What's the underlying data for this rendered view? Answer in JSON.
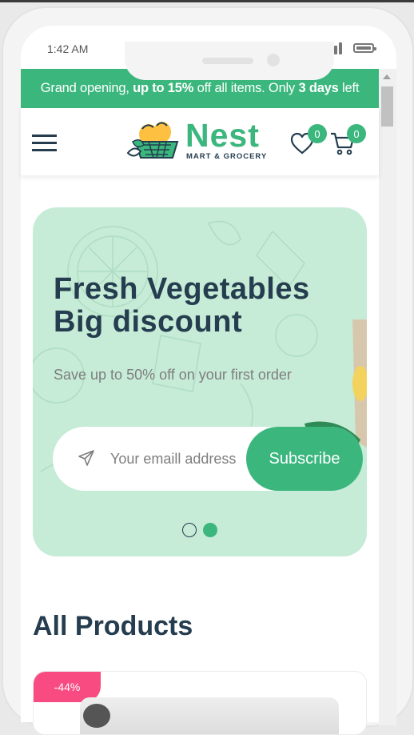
{
  "status": {
    "time": "1:42 AM",
    "signal_icon": "signal-bars-icon",
    "battery_icon": "battery-icon"
  },
  "announcement": {
    "prefix": "Grand opening, ",
    "highlight1": "up to 15%",
    "middle": " off all items. Only ",
    "highlight2": "3 days",
    "suffix": " left"
  },
  "header": {
    "menu_icon": "hamburger-menu-icon",
    "logo_name": "Nest",
    "logo_tagline": "MART & GROCERY",
    "wishlist_icon": "heart-icon",
    "wishlist_count": "0",
    "cart_icon": "shopping-cart-icon",
    "cart_count": "0"
  },
  "hero": {
    "title_line1": "Fresh Vegetables",
    "title_line2": "Big discount",
    "subtitle": "Save up to 50% off on your first order",
    "email_placeholder": "Your emaill address",
    "send_icon": "paper-plane-icon",
    "subscribe_label": "Subscribe",
    "slide_count": 2,
    "active_slide": 2
  },
  "products": {
    "section_title": "All Products",
    "items": [
      {
        "discount": "-44%"
      }
    ]
  },
  "colors": {
    "brand": "#3bb77e",
    "heading": "#253d4e",
    "hero_bg": "#c6ebd7",
    "discount_badge": "#f74b81",
    "muted_text": "#7e7e7e"
  }
}
